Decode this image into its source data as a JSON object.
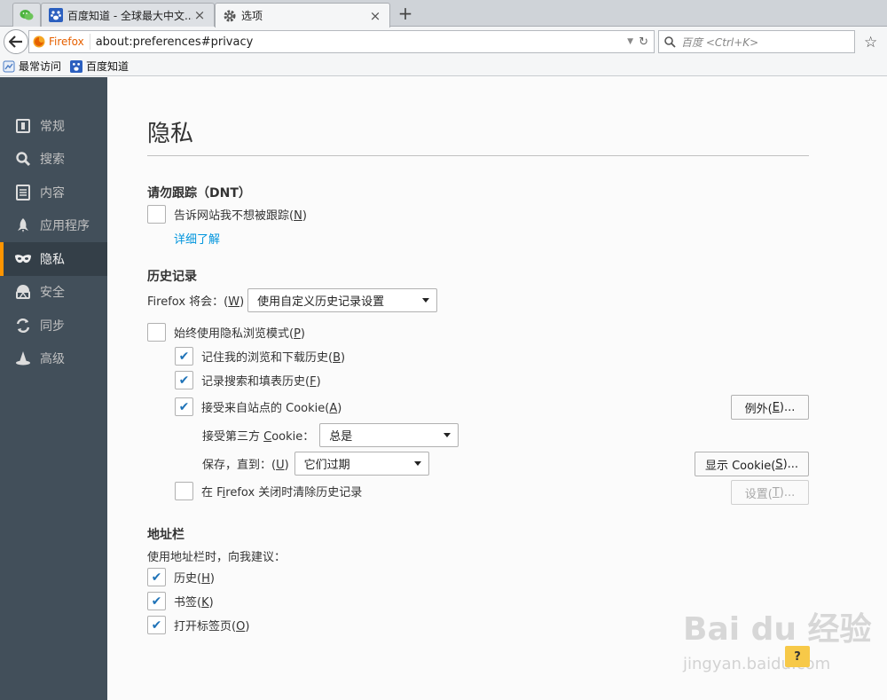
{
  "tabs": [
    {
      "title": "",
      "icon": "wechat-icon",
      "active": false
    },
    {
      "title": "百度知道 - 全球最大中文...",
      "icon": "baidu-paw-icon",
      "active": false
    },
    {
      "title": "选项",
      "icon": "gear-icon",
      "active": true
    }
  ],
  "nav": {
    "identity_label": "Firefox",
    "url": "about:preferences#privacy",
    "search_placeholder": "百度 <Ctrl+K>"
  },
  "bookmarks": [
    {
      "label": "最常访问",
      "icon": "most-visited-icon"
    },
    {
      "label": "百度知道",
      "icon": "baidu-paw-icon"
    }
  ],
  "sidebar": {
    "items": [
      {
        "label": "常规",
        "icon": "general-icon"
      },
      {
        "label": "搜索",
        "icon": "search-icon"
      },
      {
        "label": "内容",
        "icon": "content-icon"
      },
      {
        "label": "应用程序",
        "icon": "rocket-icon"
      },
      {
        "label": "隐私",
        "icon": "mask-icon",
        "selected": true
      },
      {
        "label": "安全",
        "icon": "security-icon"
      },
      {
        "label": "同步",
        "icon": "sync-icon"
      },
      {
        "label": "高级",
        "icon": "wizard-hat-icon"
      }
    ]
  },
  "page": {
    "title": "隐私",
    "dnt": {
      "heading": "请勿跟踪（DNT）",
      "checkbox_pre": "告诉网站我不想被跟踪(",
      "checkbox_key": "N",
      "checkbox_post": ")",
      "checked": false,
      "learn_more": "详细了解"
    },
    "history": {
      "heading": "历史记录",
      "mode_label_pre": "Firefox 将会：(",
      "mode_label_key": "W",
      "mode_label_post": ")",
      "mode_value": "使用自定义历史记录设置",
      "private_pre": "始终使用隐私浏览模式(",
      "private_key": "P",
      "private_post": ")",
      "private_checked": false,
      "remember_pre": "记住我的浏览和下载历史(",
      "remember_key": "B",
      "remember_post": ")",
      "remember_checked": true,
      "forms_pre": "记录搜索和填表历史(",
      "forms_key": "F",
      "forms_post": ")",
      "forms_checked": true,
      "cookies_pre": "接受来自站点的 Cookie(",
      "cookies_key": "A",
      "cookies_post": ")",
      "cookies_checked": true,
      "exceptions_btn_pre": "例外(",
      "exceptions_btn_key": "E",
      "exceptions_btn_post": ")...",
      "third_party_pre": "接受第三方 ",
      "third_party_key": "C",
      "third_party_post": "ookie：",
      "third_party_value": "总是",
      "keep_label_pre": "保存，直到：(",
      "keep_label_key": "U",
      "keep_label_post": ")",
      "keep_value": "它们过期",
      "show_cookies_pre": "显示 Cookie(",
      "show_cookies_key": "S",
      "show_cookies_post": ")...",
      "clear_pre": "在 F",
      "clear_key": "i",
      "clear_post": "refox 关闭时清除历史记录",
      "clear_checked": false,
      "settings_btn_pre": "设置(",
      "settings_btn_key": "T",
      "settings_btn_post": ")..."
    },
    "locationbar": {
      "heading": "地址栏",
      "subtitle": "使用地址栏时，向我建议：",
      "history_pre": "历史(",
      "history_key": "H",
      "history_post": ")",
      "history_checked": true,
      "bookmarks_pre": "书签(",
      "bookmarks_key": "K",
      "bookmarks_post": ")",
      "bookmarks_checked": true,
      "tabs_pre": "打开标签页(",
      "tabs_key": "O",
      "tabs_post": ")",
      "tabs_checked": true
    },
    "help_label": "?"
  },
  "watermark": {
    "brand": "Bai du 经验",
    "site": "jingyan.baidu.com"
  },
  "colors": {
    "sidebar_bg": "#424f5a",
    "sidebar_selected": "#343f48",
    "accent_orange": "#ff9500",
    "link_blue": "#0095dd",
    "check_blue": "#1f73b8"
  }
}
